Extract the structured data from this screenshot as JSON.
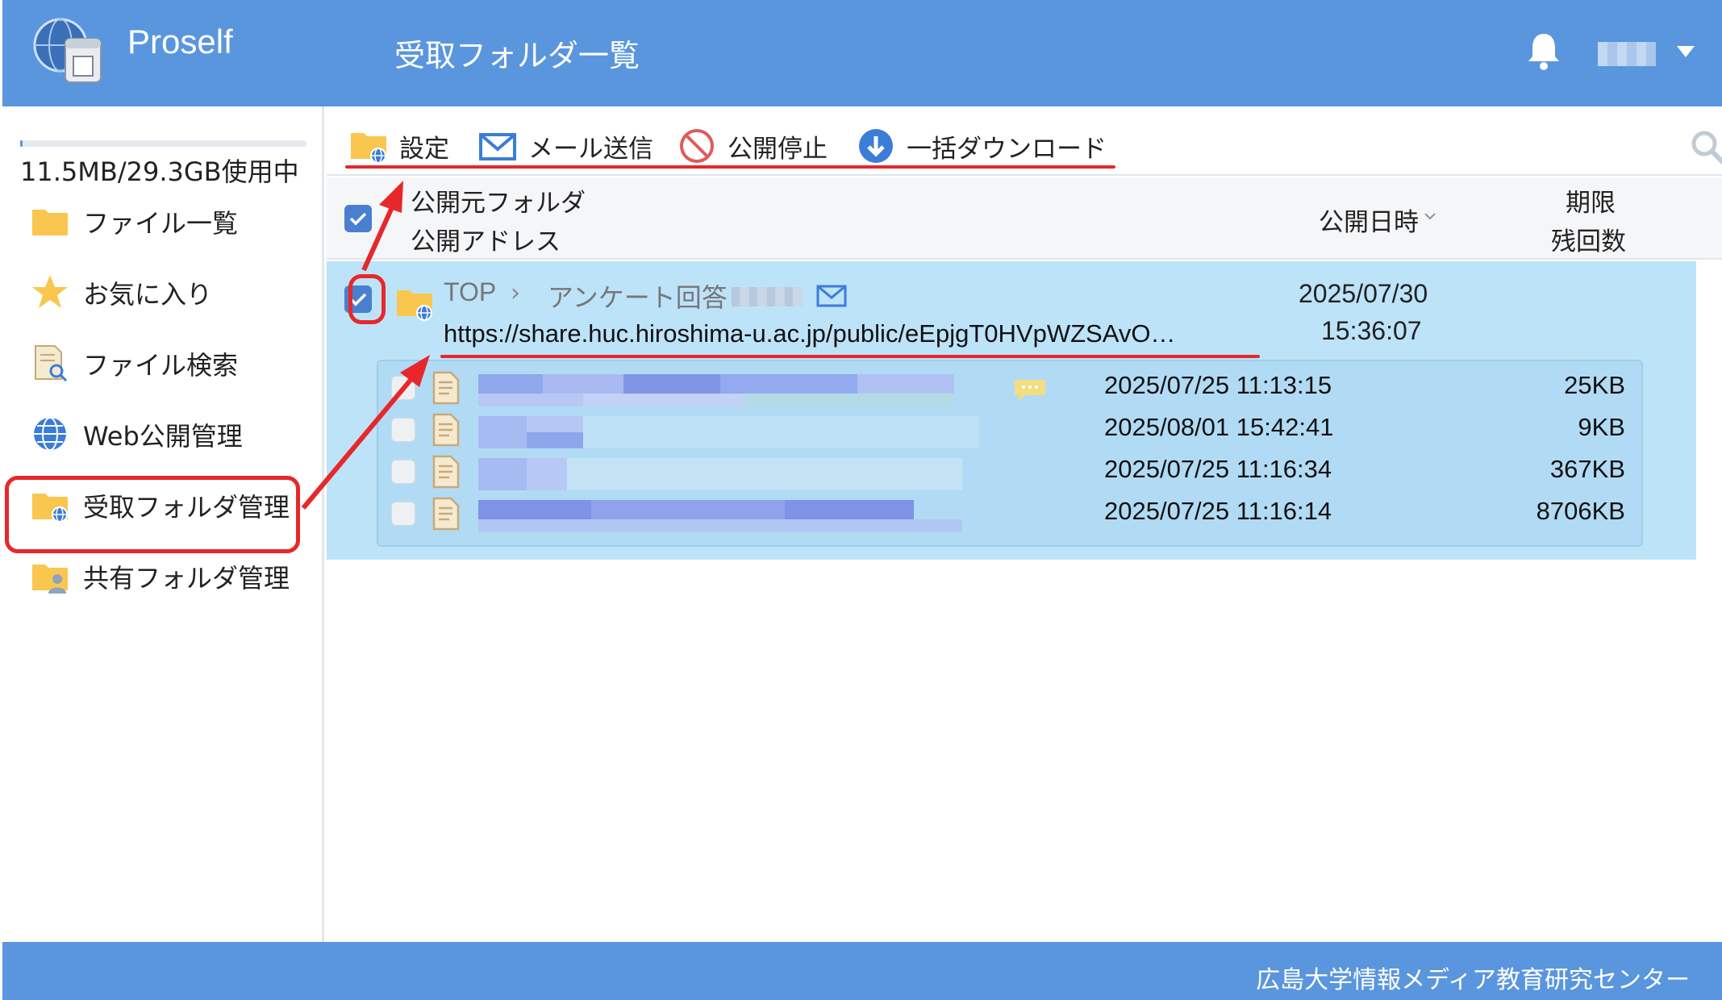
{
  "header": {
    "app_name": "Proself",
    "page_title": "受取フォルダ一覧",
    "icons": [
      "proself-logo-icon",
      "bell-icon",
      "chevron-down-icon"
    ]
  },
  "sidebar": {
    "quota_used_fraction": 0.0004,
    "quota_text": "11.5MB/29.3GB使用中",
    "items": [
      {
        "label": "ファイル一覧",
        "icon": "folder-icon"
      },
      {
        "label": "お気に入り",
        "icon": "star-icon"
      },
      {
        "label": "ファイル検索",
        "icon": "file-search-icon"
      },
      {
        "label": "Web公開管理",
        "icon": "globe-icon"
      },
      {
        "label": "受取フォルダ管理",
        "icon": "receive-folder-icon",
        "active": true
      },
      {
        "label": "共有フォルダ管理",
        "icon": "shared-folder-icon"
      }
    ]
  },
  "toolbar": {
    "settings_label": "設定",
    "mail_label": "メール送信",
    "stop_label": "公開停止",
    "download_label": "一括ダウンロード"
  },
  "list_header": {
    "col_source": "公開元フォルダ",
    "col_address": "公開アドレス",
    "col_date": "公開日時",
    "col_expire_1": "期限",
    "col_expire_2": "残回数"
  },
  "row": {
    "checked": true,
    "crumb_root": "TOP",
    "crumb_sep": "›",
    "crumb_folder": "アンケート回答",
    "url": "https://share.huc.hiroshima-u.ac.jp/public/eEpjgT0HVpWZSAvO…",
    "date": "2025/07/30",
    "time": "15:36:07",
    "files": [
      {
        "date": "2025/07/25 11:13:15",
        "size": "25KB"
      },
      {
        "date": "2025/08/01 15:42:41",
        "size": "9KB"
      },
      {
        "date": "2025/07/25 11:16:34",
        "size": "367KB"
      },
      {
        "date": "2025/07/25 11:16:14",
        "size": "8706KB"
      }
    ]
  },
  "footer": {
    "text": "広島大学情報メディア教育研究センター"
  },
  "colors": {
    "header_bg": "#5a96dd",
    "selected_row_bg": "#bde3f9",
    "annotation_red": "#e8272a",
    "checkbox_blue": "#4a7fcf"
  }
}
